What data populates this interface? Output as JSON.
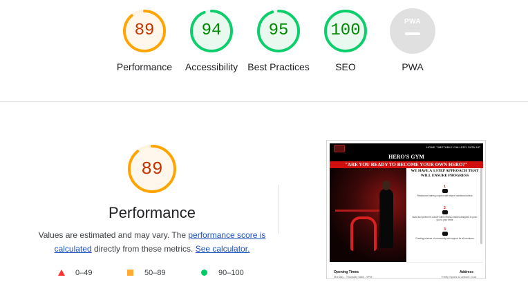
{
  "categories": [
    {
      "id": "performance",
      "label": "Performance",
      "score": 89,
      "fraction": 0.89,
      "color": "#ffa400",
      "track": "#fff3e0",
      "fill_bg": "#fff7ec",
      "text_color": "#c33300"
    },
    {
      "id": "accessibility",
      "label": "Accessibility",
      "score": 94,
      "fraction": 0.94,
      "color": "#0cce6b",
      "track": "#e5f7ee",
      "fill_bg": "#e9f9f0",
      "text_color": "#008800"
    },
    {
      "id": "best-practices",
      "label": "Best Practices",
      "score": 95,
      "fraction": 0.95,
      "color": "#0cce6b",
      "track": "#e5f7ee",
      "fill_bg": "#e9f9f0",
      "text_color": "#008800"
    },
    {
      "id": "seo",
      "label": "SEO",
      "score": 100,
      "fraction": 1.0,
      "color": "#0cce6b",
      "track": "#e5f7ee",
      "fill_bg": "#e9f9f0",
      "text_color": "#008800"
    }
  ],
  "pwa": {
    "label": "PWA",
    "badge_text": "PWA"
  },
  "performance_section": {
    "score": 89,
    "fraction": 0.89,
    "title": "Performance",
    "desc_before": "Values are estimated and may vary. The ",
    "link_score": "performance score is calculated",
    "desc_middle": " directly from these metrics. ",
    "link_calculator": "See calculator."
  },
  "legend": {
    "fail": "0–49",
    "average": "50–89",
    "pass": "90–100"
  },
  "colors": {
    "fail": "#ff3333",
    "average": "#ffaa33",
    "pass": "#00cc66",
    "link": "#1a4fbf"
  },
  "screenshot": {
    "nav_links": "HOME  TIMETABLE  GALLERY  SIGN UP",
    "hero_title": "HERO'S GYM",
    "tagline": "\"ARE YOU READY TO BECOME YOUR OWN HERO?\"",
    "steps_heading": "WE HAVE A 3 STEP APPROACH THAT WILL ENSURE PROGRESS",
    "steps": [
      {
        "num": "1",
        "text": "Resistance training coupled with expert nutritional advice"
      },
      {
        "num": "2",
        "text": "Build and protect fit-culture within fitness classes designed to push you to your limits"
      },
      {
        "num": "3",
        "text": "Creating a sense of community and support for all members"
      }
    ],
    "footer_left": "Opening Times",
    "footer_left_sub": "Monday - Thursday 6AM - 9PM",
    "footer_right": "Address",
    "footer_right_sub": "Trinity Sports & Leisure Club"
  }
}
